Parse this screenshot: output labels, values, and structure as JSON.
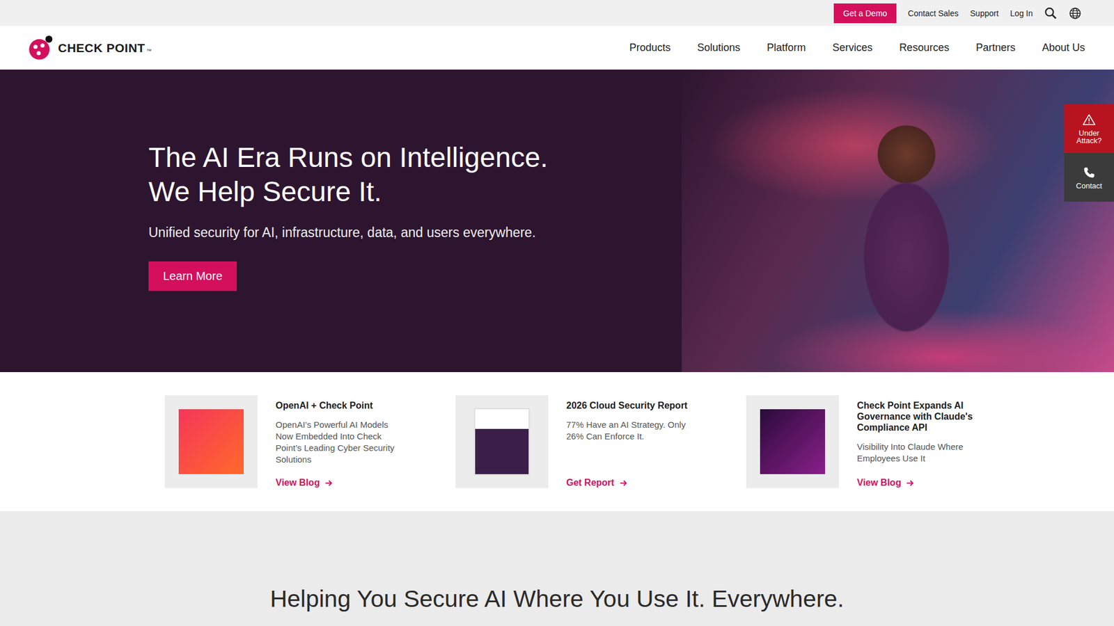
{
  "top_bar": {
    "demo_button": "Get a Demo",
    "links": [
      "Contact Sales",
      "Support",
      "Log In"
    ]
  },
  "logo": {
    "text": "CHECK POINT",
    "trademark": "™"
  },
  "nav": {
    "items": [
      "Products",
      "Solutions",
      "Platform",
      "Services",
      "Resources",
      "Partners",
      "About Us"
    ]
  },
  "hero": {
    "title_lines": [
      "The AI Era Runs on Intelligence.",
      "We Help Secure It."
    ],
    "subtitle": "Unified security for AI, infrastructure, data, and users everywhere.",
    "button": "Learn More"
  },
  "side_widgets": [
    {
      "label": "Under Attack?",
      "kind": "alert"
    },
    {
      "label": "Contact",
      "kind": "contact"
    }
  ],
  "cards": [
    {
      "kind": "redtile",
      "title": "OpenAI + Check Point",
      "description": "OpenAI’s Powerful AI Models Now Embedded Into Check Point’s Leading Cyber Security Solutions",
      "link": "View Blog"
    },
    {
      "kind": "document",
      "title": "2026 Cloud Security Report",
      "description": "77% Have an AI Strategy. Only 26% Can Enforce It.",
      "link": "Get Report"
    },
    {
      "kind": "purpletile",
      "title": "Check Point Expands AI Governance with Claude's Compliance API",
      "description": "Visibility Into Claude Where Employees Use It",
      "link": "View Blog"
    }
  ],
  "section": {
    "heading": "Helping You Secure AI Where You Use It. Everywhere."
  }
}
